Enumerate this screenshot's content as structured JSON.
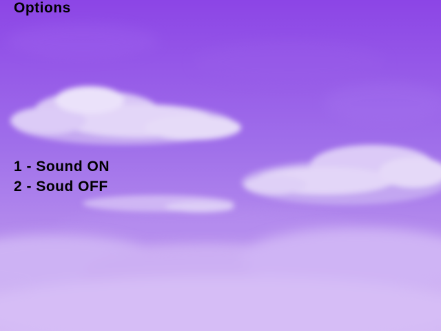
{
  "screen": {
    "title": "Options",
    "options": [
      {
        "label": "1 - Sound ON"
      },
      {
        "label": "2 - Soud OFF"
      }
    ]
  },
  "colors": {
    "sky_top": "#8c45e6",
    "sky_mid": "#a676ec",
    "sky_bottom": "#d2b7f4",
    "cloud": "#e7dcf8",
    "text": "#000000"
  }
}
